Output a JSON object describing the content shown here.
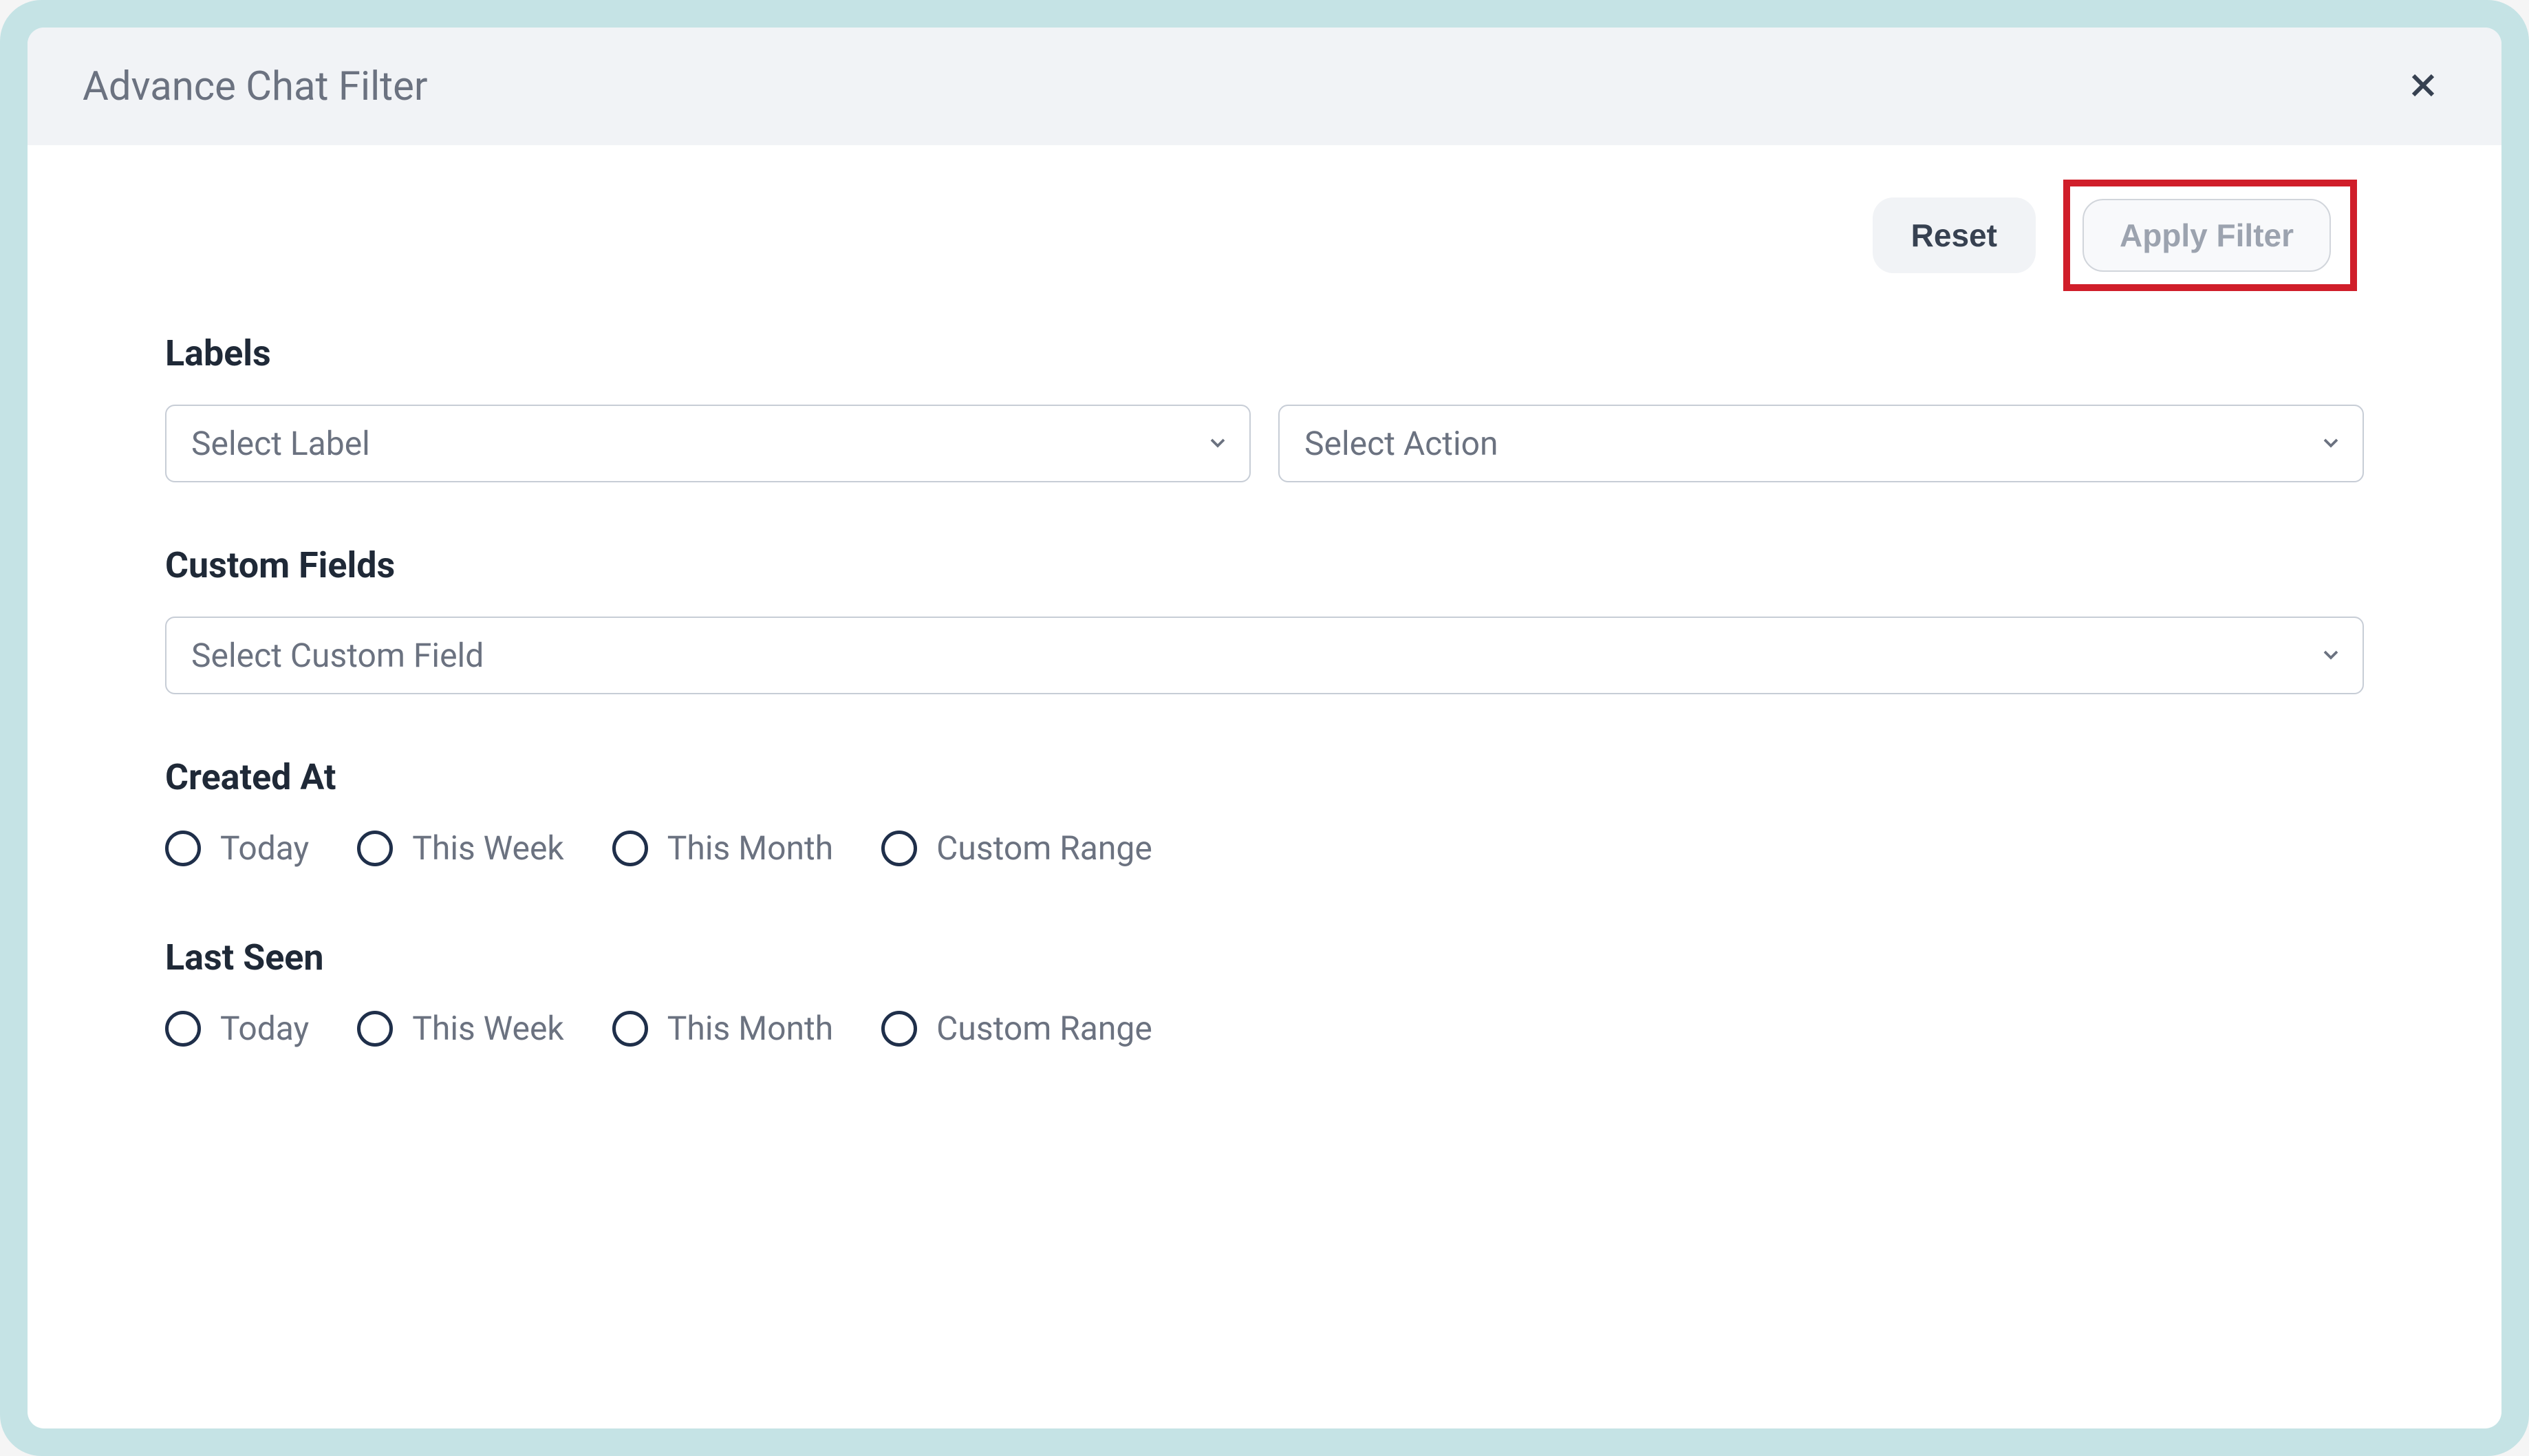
{
  "dialog": {
    "title": "Advance Chat Filter"
  },
  "actions": {
    "reset_label": "Reset",
    "apply_label": "Apply Filter"
  },
  "sections": {
    "labels": {
      "heading": "Labels",
      "select_label_placeholder": "Select Label",
      "select_action_placeholder": "Select Action"
    },
    "custom_fields": {
      "heading": "Custom Fields",
      "select_placeholder": "Select Custom Field"
    },
    "created_at": {
      "heading": "Created At",
      "options": [
        "Today",
        "This Week",
        "This Month",
        "Custom Range"
      ]
    },
    "last_seen": {
      "heading": "Last Seen",
      "options": [
        "Today",
        "This Week",
        "This Month",
        "Custom Range"
      ]
    }
  },
  "highlight": {
    "color": "#d01e2a"
  }
}
